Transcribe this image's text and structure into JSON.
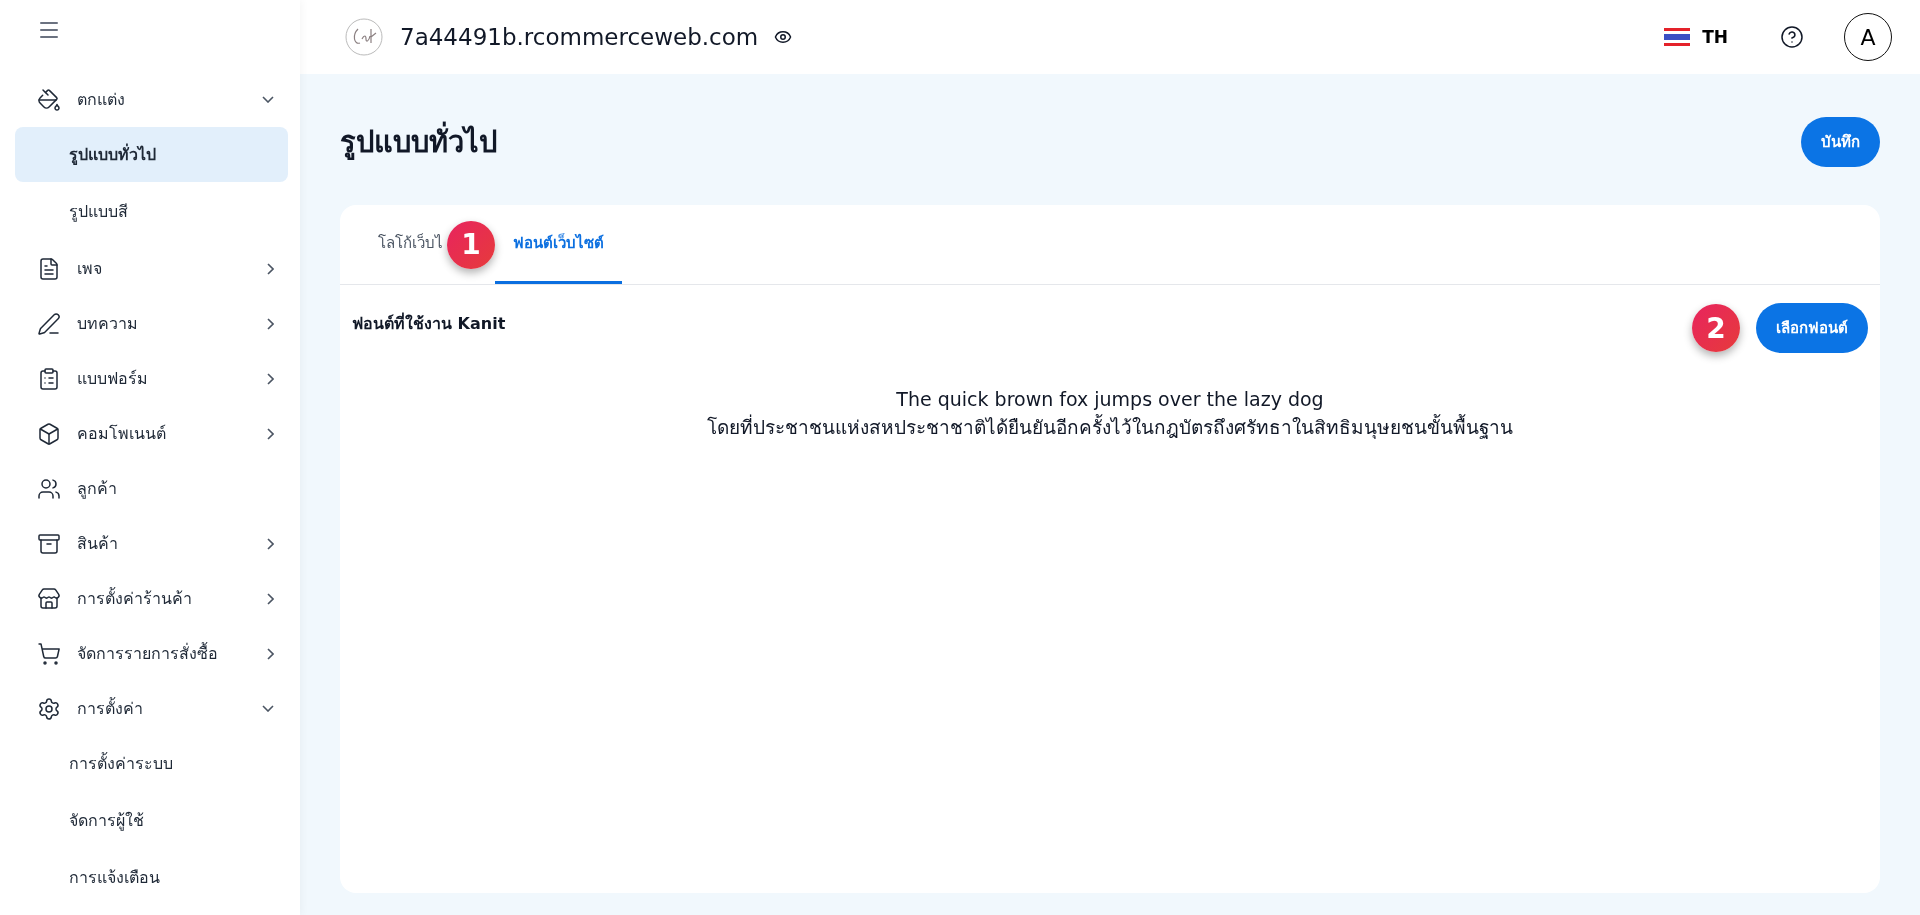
{
  "header": {
    "site": "7a44491b.rcommerceweb.com",
    "language": "TH",
    "avatar": "A"
  },
  "sidebar": {
    "items": [
      {
        "label": "ตกแต่ง",
        "expanded": true,
        "children": [
          {
            "label": "รูปแบบทั่วไป",
            "selected": true
          },
          {
            "label": "รูปแบบสี",
            "selected": false
          }
        ]
      },
      {
        "label": "เพจ",
        "expanded": false
      },
      {
        "label": "บทความ",
        "expanded": false
      },
      {
        "label": "แบบฟอร์ม",
        "expanded": false
      },
      {
        "label": "คอมโพเนนต์",
        "expanded": false
      },
      {
        "label": "ลูกค้า"
      },
      {
        "label": "สินค้า",
        "expanded": false
      },
      {
        "label": "การตั้งค่าร้านค้า",
        "expanded": false
      },
      {
        "label": "จัดการรายการสั่งซื้อ",
        "expanded": false
      },
      {
        "label": "การตั้งค่า",
        "expanded": true,
        "children": [
          {
            "label": "การตั้งค่าระบบ",
            "selected": false
          },
          {
            "label": "จัดการผู้ใช้",
            "selected": false
          },
          {
            "label": "การแจ้งเตือน",
            "selected": false
          }
        ]
      }
    ]
  },
  "page": {
    "title": "รูปแบบทั่วไป",
    "save_button": "บันทึก"
  },
  "tabs": [
    {
      "label": "โลโก้เว็บไ",
      "selected": false,
      "marker": "1"
    },
    {
      "label": "ฟอนต์เว็บไซต์",
      "selected": true
    }
  ],
  "font_panel": {
    "current_font": "ฟอนต์ที่ใช้งาน Kanit",
    "select_button": "เลือกฟอนต์",
    "marker": "2",
    "sample_lines": [
      "The quick brown fox jumps over the lazy dog",
      "โดยที่ประชาชนแห่งสหประชาชาติได้ยืนยันอีกครั้งไว้ในกฎบัตรถึงศรัทธาในสิทธิมนุษยชนขั้นพื้นฐาน"
    ]
  }
}
